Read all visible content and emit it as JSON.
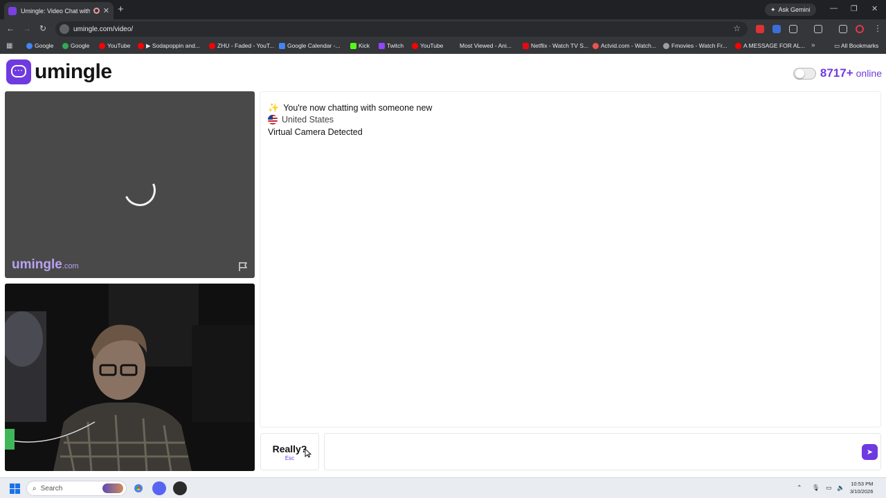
{
  "browser": {
    "tab_title": "Umingle: Video Chat with S",
    "tab_close": "✕",
    "new_tab": "+",
    "ask_gemini": "Ask Gemini",
    "url": "umingle.com/video/",
    "bookmarks": [
      {
        "label": "Google",
        "color": "#4285f4"
      },
      {
        "label": "Google",
        "color": "#34a853"
      },
      {
        "label": "YouTube",
        "color": "#ff0000"
      },
      {
        "label": "▶ Sodapoppin and...",
        "color": "#ff0000"
      },
      {
        "label": "ZHU - Faded - YouT...",
        "color": "#ff0000"
      },
      {
        "label": "Google Calendar -...",
        "color": "#4285f4"
      },
      {
        "label": "Kick",
        "color": "#53fc18"
      },
      {
        "label": "Twitch",
        "color": "#9146ff"
      },
      {
        "label": "YouTube",
        "color": "#ff0000"
      },
      {
        "label": "Most Viewed - Ani...",
        "color": "#35363a"
      },
      {
        "label": "Netflix - Watch TV S...",
        "color": "#e50914"
      },
      {
        "label": "Actvid.com - Watch...",
        "color": "#e8554e"
      },
      {
        "label": "Fmovies - Watch Fr...",
        "color": "#9aa0a6"
      },
      {
        "label": "A MESSAGE FOR AL...",
        "color": "#ff0000"
      }
    ],
    "all_bookmarks": "All Bookmarks"
  },
  "header": {
    "logo_text": "umingle",
    "online_count": "8717+",
    "online_label": "online",
    "brand_color": "#6f3ae0"
  },
  "stranger": {
    "watermark": "umingle",
    "watermark_suffix": ".com"
  },
  "chat": {
    "status_line": "You're now chatting with someone new",
    "country": "United States",
    "notice": "Virtual Camera Detected"
  },
  "controls": {
    "skip_label": "Really?",
    "skip_key": "Esc",
    "input_value": "",
    "send_icon": "send-icon"
  },
  "taskbar": {
    "search_placeholder": "Search",
    "time": "10:53 PM",
    "date": "3/10/2026"
  }
}
